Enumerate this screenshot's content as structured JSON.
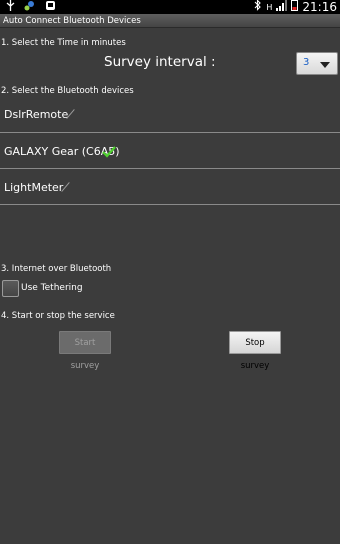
{
  "statusbar": {
    "time": "21:16",
    "left_icons": [
      "usb-icon",
      "dropbox-icon",
      "android-icon"
    ],
    "right_icons": [
      "bluetooth-icon",
      "h-network-icon",
      "signal-icon",
      "battery-low-icon"
    ],
    "network_label": "H"
  },
  "app": {
    "title": "Auto Connect Bluetooth Devices"
  },
  "section1": {
    "label": "1. Select the Time in minutes",
    "survey_label": "Survey interval :",
    "spinner_value": "3"
  },
  "section2": {
    "label": "2. Select the Bluetooth devices",
    "devices": [
      {
        "name": "DslrRemote",
        "status_icon": "pencil-icon"
      },
      {
        "name": "GALAXY Gear (C6A5)",
        "status_icon": "check-icon"
      },
      {
        "name": "LightMeter",
        "status_icon": "pencil-icon"
      }
    ]
  },
  "section3": {
    "label": "3. Internet over Bluetooth",
    "checkbox_label": "Use Tethering",
    "checked": false
  },
  "section4": {
    "label": "4. Start or stop the service",
    "start_label": "Start survey",
    "stop_label": "Stop survey"
  },
  "colors": {
    "background": "#3c3c3c",
    "check": "#4fd12f",
    "spinner_text": "#1a5fc4"
  }
}
